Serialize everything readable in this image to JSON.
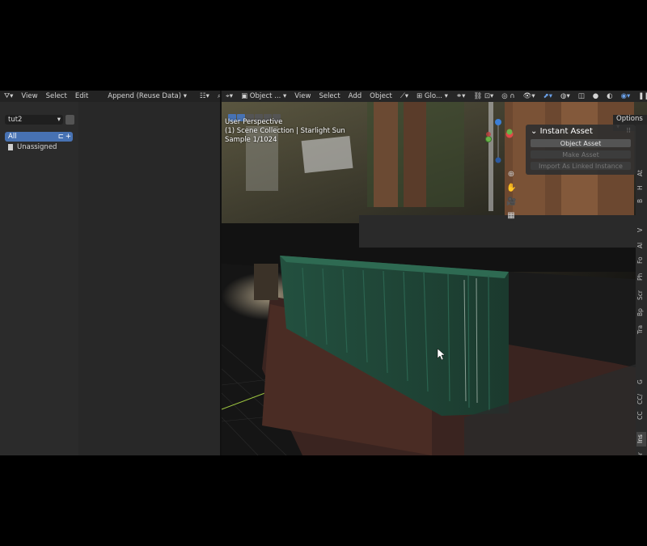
{
  "left_header": {
    "menu": [
      "View",
      "Select",
      "Edit"
    ],
    "import_mode": "Append (Reuse Data)"
  },
  "library": {
    "name": "tut2"
  },
  "catalogs": [
    {
      "label": "All",
      "selected": true
    },
    {
      "label": "Unassigned",
      "selected": false
    }
  ],
  "viewport_header": {
    "mode": "Object ...",
    "menu": [
      "View",
      "Select",
      "Add",
      "Object"
    ],
    "orientation": "Glo...",
    "options": "Options"
  },
  "viewport_overlay": {
    "line1": "User Perspective",
    "line2": "(1) Scene Collection | Starlight Sun",
    "line3": "Sample 1/1024"
  },
  "instant_asset_panel": {
    "title": "Instant Asset",
    "buttons": [
      {
        "label": "Object Asset",
        "enabled": true
      },
      {
        "label": "Make Asset",
        "enabled": false
      },
      {
        "label": "Import As Linked Instance",
        "enabled": false
      }
    ]
  },
  "sidebar_tabs": [
    "At",
    "H",
    "B",
    "V",
    "Al",
    "Fo",
    "Ph",
    "Scr",
    "Bp",
    "Tra",
    "G",
    "CC/",
    "CC",
    "Ins",
    "Gr"
  ],
  "colors": {
    "accent": "#4772b3",
    "container": "#1f4a3a"
  }
}
